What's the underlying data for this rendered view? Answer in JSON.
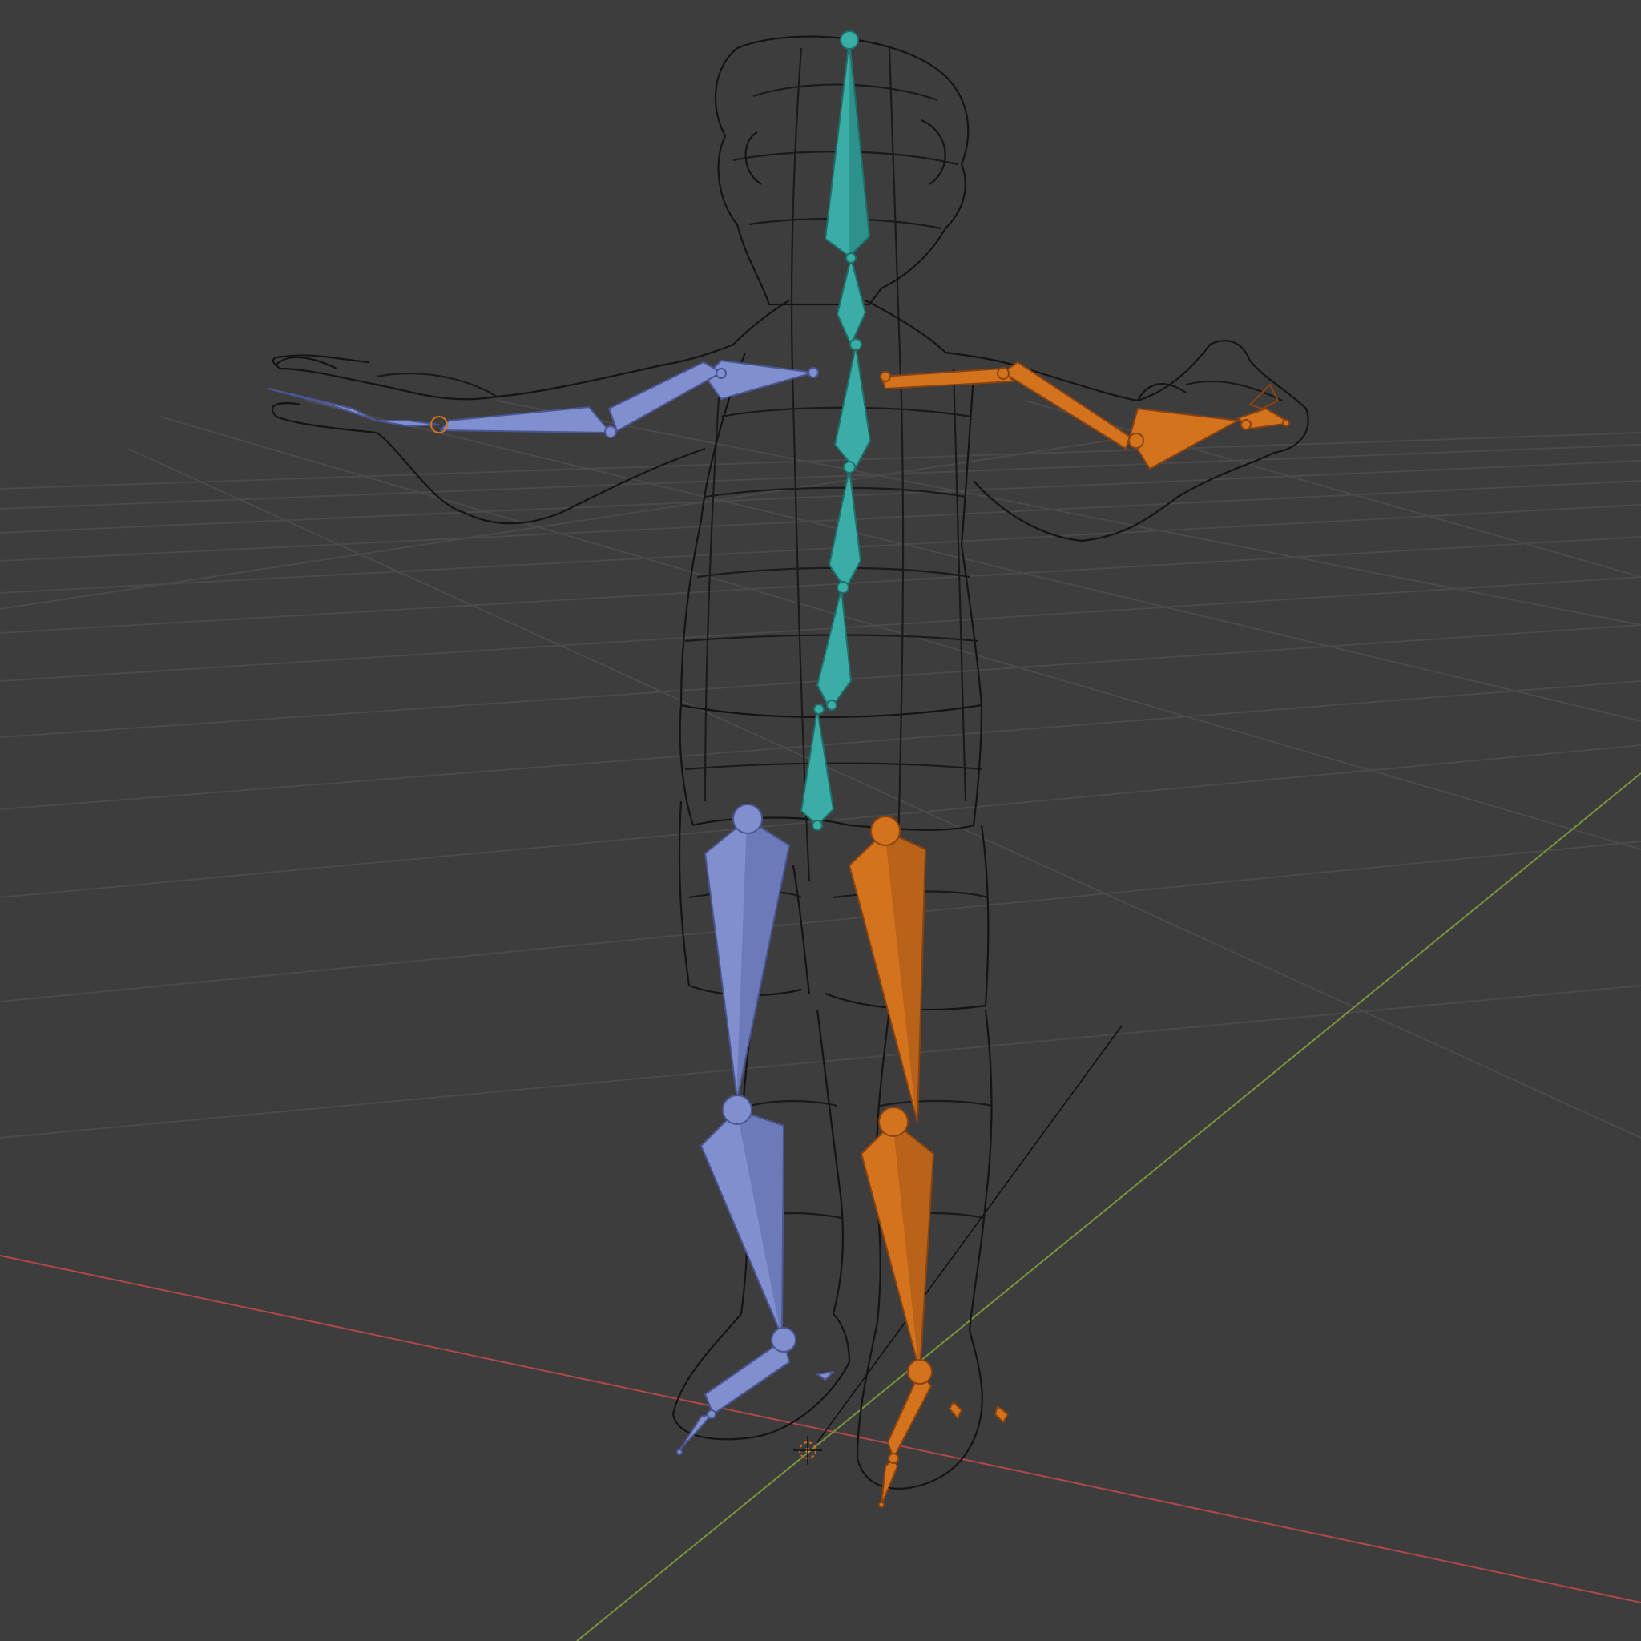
{
  "viewport": {
    "editor": "3D Viewport",
    "shading": "wireframe",
    "background_color": "#3d3d3d",
    "grid_color": "#4a4a4a",
    "x_axis_color": "#b0484a",
    "y_axis_color": "#77953a"
  },
  "scene": {
    "mesh": {
      "object": "character-mesh",
      "display": "wireframe",
      "wire_color": "#141414"
    },
    "armature": {
      "display": "octahedral",
      "bone_groups": [
        {
          "name": "center",
          "color": "#3aada6"
        },
        {
          "name": "right-side",
          "color": "#7f8fd0"
        },
        {
          "name": "left-side",
          "color": "#d4731e"
        }
      ]
    },
    "origin_marker": "3d-cursor"
  }
}
